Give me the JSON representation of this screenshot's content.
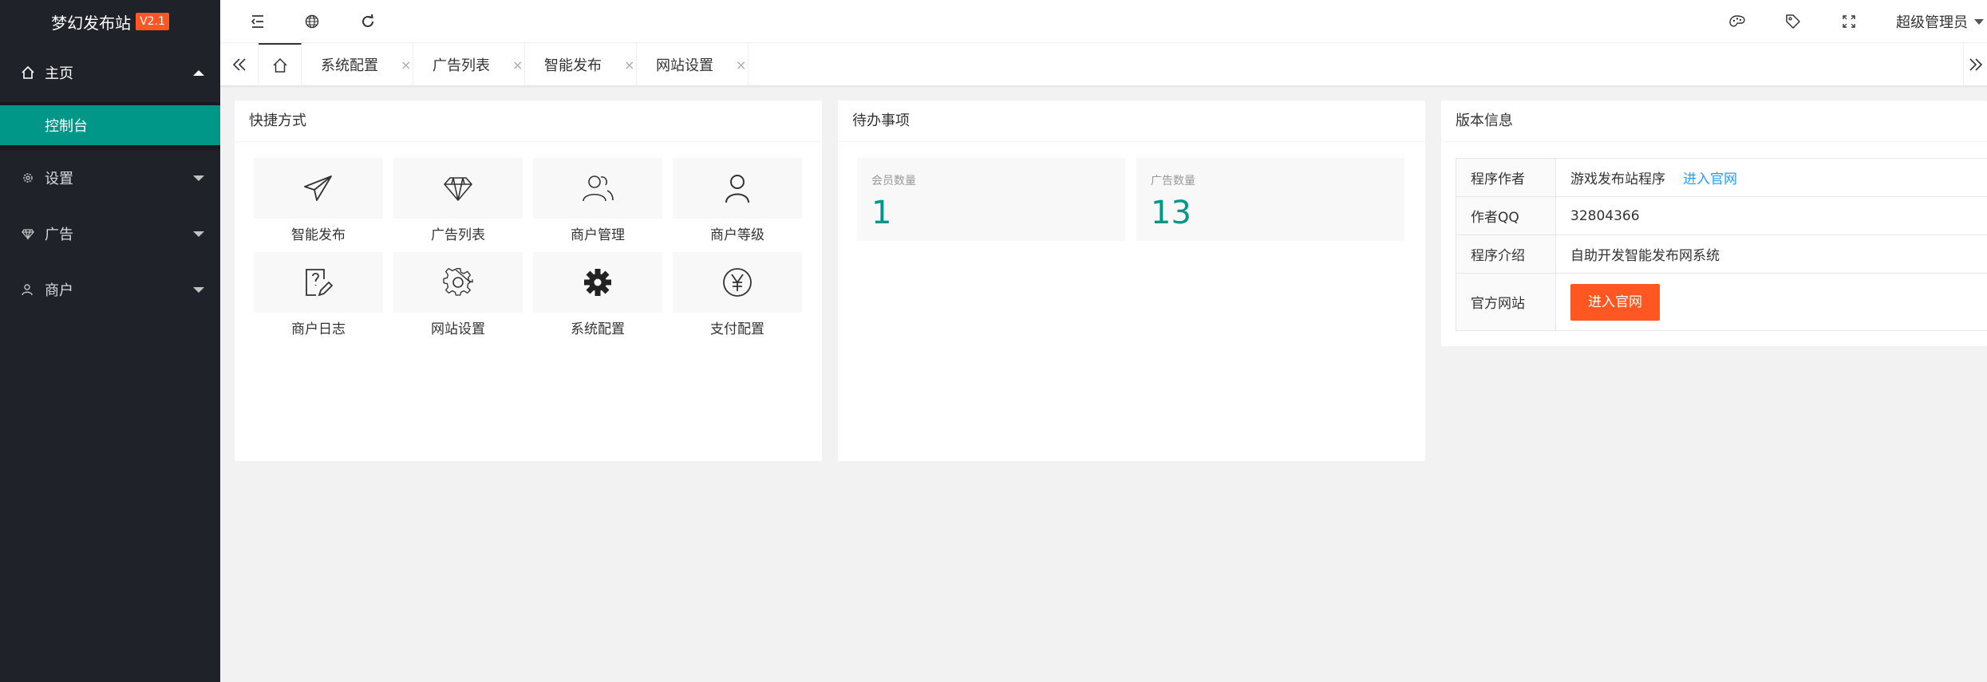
{
  "brand": {
    "name": "梦幻发布站",
    "version": "V2.1"
  },
  "sidebar": {
    "items": [
      {
        "label": "主页",
        "icon": "home-icon",
        "expanded": true,
        "children": [
          {
            "label": "控制台",
            "active": true
          }
        ]
      },
      {
        "label": "设置",
        "icon": "gear-icon",
        "expanded": false
      },
      {
        "label": "广告",
        "icon": "diamond-icon",
        "expanded": false
      },
      {
        "label": "商户",
        "icon": "user-icon",
        "expanded": false
      }
    ]
  },
  "header": {
    "icons": [
      "menu-fold-icon",
      "globe-icon",
      "refresh-icon",
      "theme-icon",
      "tag-icon",
      "fullscreen-icon"
    ],
    "user": "超级管理员"
  },
  "tabs": {
    "items": [
      {
        "label": "系统配置"
      },
      {
        "label": "广告列表"
      },
      {
        "label": "智能发布"
      },
      {
        "label": "网站设置"
      }
    ],
    "close_glyph": "×"
  },
  "shortcuts": {
    "title": "快捷方式",
    "items": [
      {
        "label": "智能发布",
        "icon": "paper-plane-icon"
      },
      {
        "label": "广告列表",
        "icon": "diamond-icon"
      },
      {
        "label": "商户管理",
        "icon": "users-icon"
      },
      {
        "label": "商户等级",
        "icon": "user-icon"
      },
      {
        "label": "商户日志",
        "icon": "log-edit-icon"
      },
      {
        "label": "网站设置",
        "icon": "gear-outline-icon"
      },
      {
        "label": "系统配置",
        "icon": "gear-solid-icon"
      },
      {
        "label": "支付配置",
        "icon": "yen-icon"
      }
    ]
  },
  "todo": {
    "title": "待办事项",
    "stats": [
      {
        "caption": "会员数量",
        "value": "1"
      },
      {
        "caption": "广告数量",
        "value": "13"
      }
    ]
  },
  "version_info": {
    "title": "版本信息",
    "rows": [
      {
        "key": "程序作者",
        "value": "游戏发布站程序",
        "link": "进入官网"
      },
      {
        "key": "作者QQ",
        "value": "32804366"
      },
      {
        "key": "程序介绍",
        "value": "自助开发智能发布网系统"
      },
      {
        "key": "官方网站",
        "button": "进入官网"
      }
    ]
  },
  "colors": {
    "sidebar": "#20222a",
    "active": "#009688",
    "accent": "#ff5722",
    "link": "#1e9fff"
  }
}
